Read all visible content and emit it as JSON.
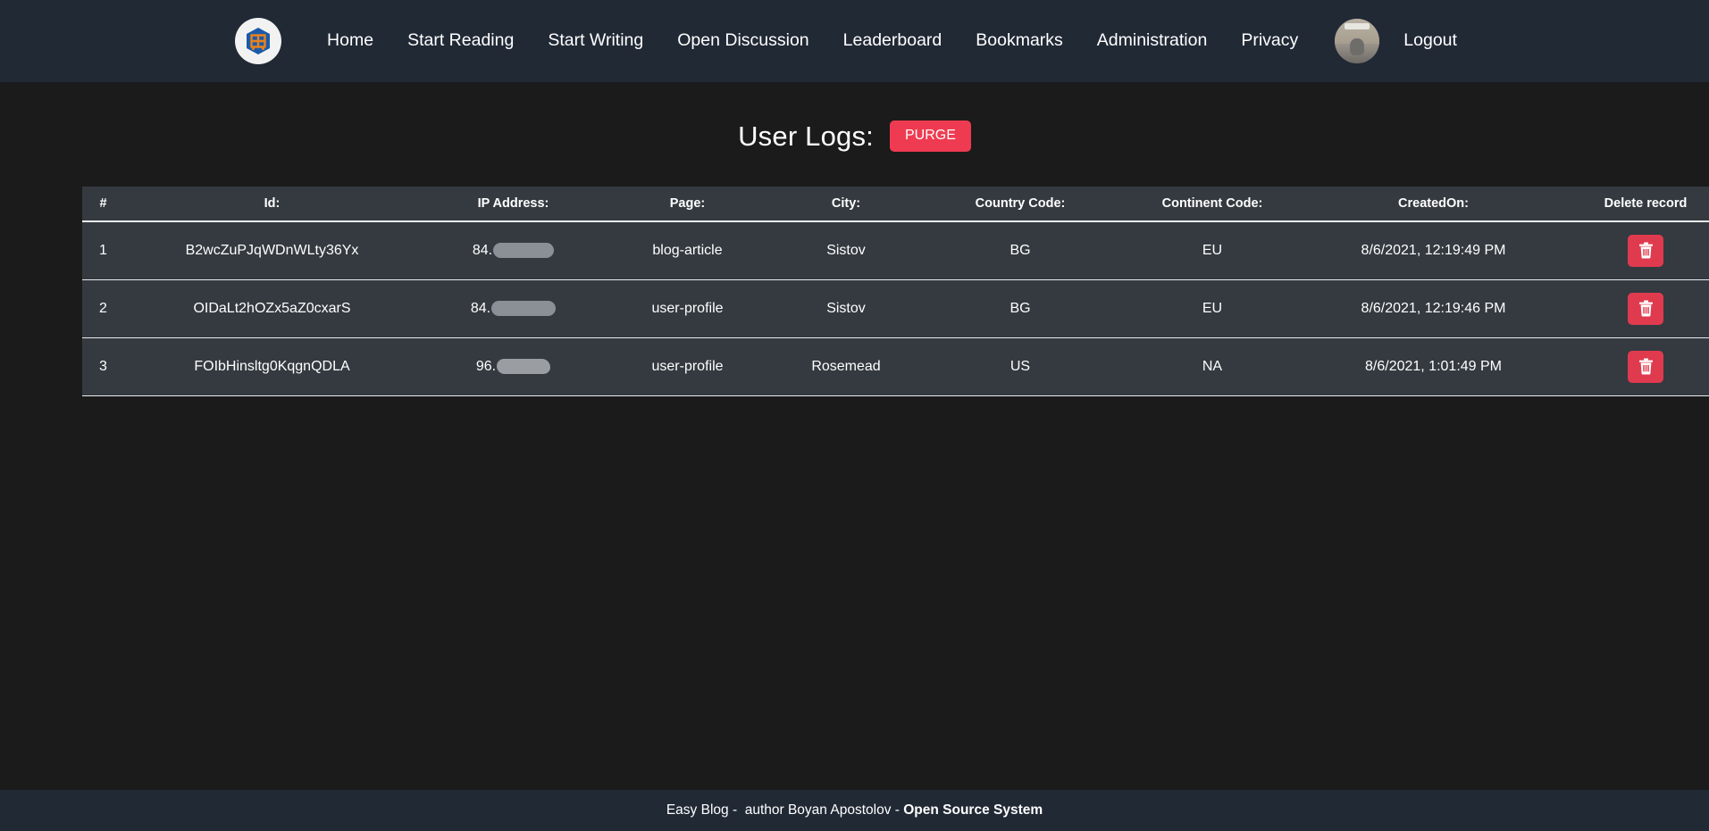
{
  "navbar": {
    "brand_alt": "Easy Blog logo",
    "links": [
      {
        "label": "Home"
      },
      {
        "label": "Start Reading"
      },
      {
        "label": "Start Writing"
      },
      {
        "label": "Open Discussion"
      },
      {
        "label": "Leaderboard"
      },
      {
        "label": "Bookmarks"
      },
      {
        "label": "Administration"
      },
      {
        "label": "Privacy"
      }
    ],
    "logout_label": "Logout",
    "avatar_alt": "user avatar"
  },
  "page": {
    "title": "User Logs:",
    "purge_label": "PURGE"
  },
  "table": {
    "headers": {
      "num": "#",
      "id": "Id:",
      "ip": "IP Address:",
      "page": "Page:",
      "city": "City:",
      "country_code": "Country Code:",
      "continent_code": "Continent Code:",
      "created_on": "CreatedOn:",
      "delete": "Delete record"
    },
    "rows": [
      {
        "num": "1",
        "id": "B2wcZuPJqWDnWLty36Yx",
        "ip_prefix": "84.",
        "ip_redacted": true,
        "page": "blog-article",
        "city": "Sistov",
        "country_code": "BG",
        "continent_code": "EU",
        "created_on": "8/6/2021, 12:19:49 PM"
      },
      {
        "num": "2",
        "id": "OIDaLt2hOZx5aZ0cxarS",
        "ip_prefix": "84.",
        "ip_redacted": true,
        "page": "user-profile",
        "city": "Sistov",
        "country_code": "BG",
        "continent_code": "EU",
        "created_on": "8/6/2021, 12:19:46 PM"
      },
      {
        "num": "3",
        "id": "FOIbHinsltg0KqgnQDLA",
        "ip_prefix": "96.",
        "ip_redacted": true,
        "page": "user-profile",
        "city": "Rosemead",
        "country_code": "US",
        "continent_code": "NA",
        "created_on": "8/6/2021, 1:01:49 PM"
      }
    ]
  },
  "footer": {
    "text_plain": "Easy Blog -  author Boyan Apostolov - ",
    "text_bold": "Open Source System"
  },
  "colors": {
    "navbar_bg": "#212935",
    "page_bg": "#1b1b1b",
    "table_bg": "#343a40",
    "table_border": "#e9ecef",
    "purge_red": "#ef3b51",
    "delete_red": "#e03a4e",
    "text": "#ffffff",
    "logo_blue": "#1c5aa8",
    "logo_orange": "#e8821e",
    "redaction_gray": "#8b9097"
  }
}
